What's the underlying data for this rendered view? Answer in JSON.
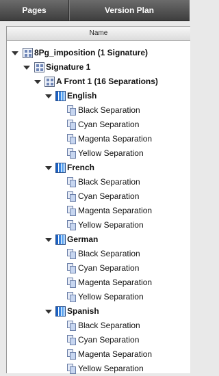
{
  "tabs": {
    "pages": "Pages",
    "version_plan": "Version Plan"
  },
  "column_header": "Name",
  "tree": {
    "root": "8Pg_imposition (1 Signature)",
    "signature": "Signature 1",
    "front": "A Front 1 (16 Separations)",
    "languages": [
      {
        "name": "English",
        "separations": [
          "Black Separation",
          "Cyan Separation",
          "Magenta Separation",
          "Yellow Separation"
        ]
      },
      {
        "name": "French",
        "separations": [
          "Black Separation",
          "Cyan Separation",
          "Magenta Separation",
          "Yellow Separation"
        ]
      },
      {
        "name": "German",
        "separations": [
          "Black Separation",
          "Cyan Separation",
          "Magenta Separation",
          "Yellow Separation"
        ]
      },
      {
        "name": "Spanish",
        "separations": [
          "Black Separation",
          "Cyan Separation",
          "Magenta Separation",
          "Yellow Separation"
        ]
      }
    ]
  },
  "icons": {
    "root": "imposition-icon",
    "signature": "signature-icon",
    "front": "surface-icon",
    "language": "language-bars-icon",
    "separation": "separation-icon"
  }
}
